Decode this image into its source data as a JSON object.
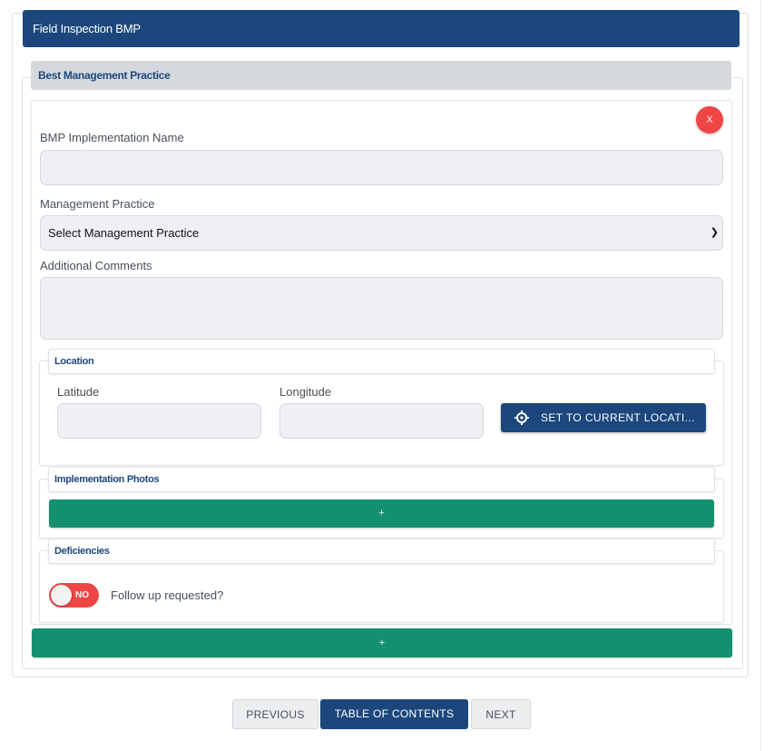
{
  "form": {
    "title": "Field Inspection BMP",
    "section_title": "Best Management Practice"
  },
  "bmp": {
    "remove_label": "X",
    "implementation_name": {
      "label": "BMP Implementation Name",
      "value": "",
      "placeholder": ""
    },
    "management_practice": {
      "label": "Management Practice",
      "selected": "Select Management Practice"
    },
    "comments": {
      "label": "Additional Comments",
      "value": "",
      "placeholder": ""
    }
  },
  "location": {
    "title": "Location",
    "latitude": {
      "label": "Latitude",
      "value": ""
    },
    "longitude": {
      "label": "Longitude",
      "value": ""
    },
    "set_button": "SET TO CURRENT LOCATI..."
  },
  "photos": {
    "title": "Implementation Photos",
    "add_label": "+"
  },
  "deficiencies": {
    "title": "Deficiencies",
    "toggle_state": "NO",
    "follow_up_label": "Follow up requested?"
  },
  "add_bmp_label": "+",
  "nav": {
    "previous": "PREVIOUS",
    "toc": "TABLE OF CONTENTS",
    "next": "NEXT"
  },
  "colors": {
    "header_blue": "#1c477d",
    "section_gray": "#d5d9dd",
    "action_green": "#14906f",
    "danger_red": "#ee4545"
  }
}
